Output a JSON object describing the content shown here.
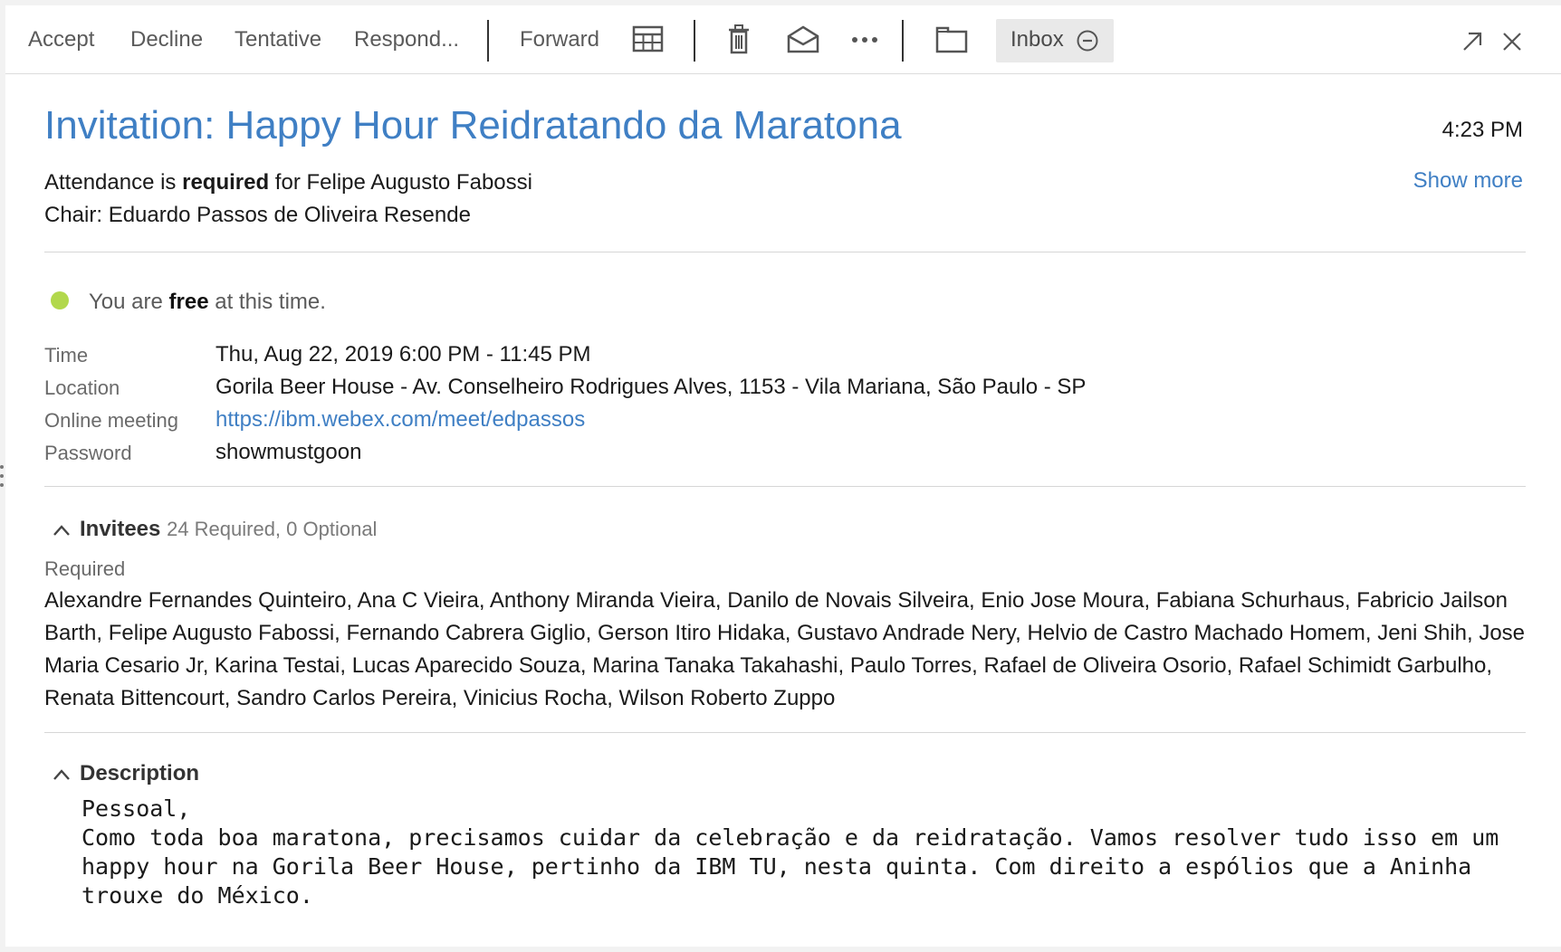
{
  "toolbar": {
    "accept": "Accept",
    "decline": "Decline",
    "tentative": "Tentative",
    "respond": "Respond...",
    "forward": "Forward",
    "inbox": "Inbox",
    "icons": [
      "calendar-grid-icon",
      "trash-icon",
      "open-envelope-icon",
      "more-icon",
      "folder-icon",
      "minus-circle-icon",
      "pop-out-icon",
      "close-icon"
    ]
  },
  "message": {
    "title": "Invitation: Happy Hour Reidratando da Maratona",
    "received_time": "4:23 PM",
    "show_more": "Show more",
    "attendance_prefix": "Attendance is ",
    "attendance_strong": "required",
    "attendance_suffix": " for Felipe Augusto Fabossi",
    "chair": "Chair: Eduardo Passos de Oliveira Resende"
  },
  "availability": {
    "prefix": "You are ",
    "strong": "free",
    "suffix": " at this time.",
    "dot_color": "#b2d84c"
  },
  "details": {
    "time_label": "Time",
    "time_value": "Thu, Aug 22, 2019 6:00 PM - 11:45 PM",
    "location_label": "Location",
    "location_value": "Gorila Beer House - Av. Conselheiro Rodrigues Alves, 1153 - Vila Mariana, São Paulo - SP",
    "online_label": "Online meeting",
    "online_value": "https://ibm.webex.com/meet/edpassos",
    "password_label": "Password",
    "password_value": "showmustgoon"
  },
  "invitees": {
    "heading": "Invitees",
    "summary": "24 Required, 0 Optional",
    "required_label": "Required",
    "required_list": "Alexandre Fernandes Quinteiro, Ana C Vieira, Anthony Miranda Vieira, Danilo de Novais Silveira, Enio Jose Moura, Fabiana Schurhaus, Fabricio Jailson Barth, Felipe Augusto Fabossi, Fernando Cabrera Giglio, Gerson Itiro Hidaka, Gustavo Andrade Nery, Helvio de Castro Machado Homem, Jeni Shih, Jose Maria Cesario Jr, Karina Testai, Lucas Aparecido Souza, Marina Tanaka Takahashi, Paulo Torres, Rafael de Oliveira Osorio, Rafael Schimidt Garbulho, Renata Bittencourt, Sandro Carlos Pereira, Vinicius Rocha, Wilson Roberto Zuppo"
  },
  "description": {
    "heading": "Description",
    "body": "Pessoal,\nComo toda boa maratona, precisamos cuidar da celebração e da reidratação. Vamos resolver tudo isso em um happy hour na Gorila Beer House, pertinho da IBM TU, nesta quinta. Com direito a espólios que a Aninha trouxe do México."
  },
  "colors": {
    "accent": "#3f7fc4",
    "text": "#1a1a1a",
    "muted": "#6a6a6a"
  }
}
